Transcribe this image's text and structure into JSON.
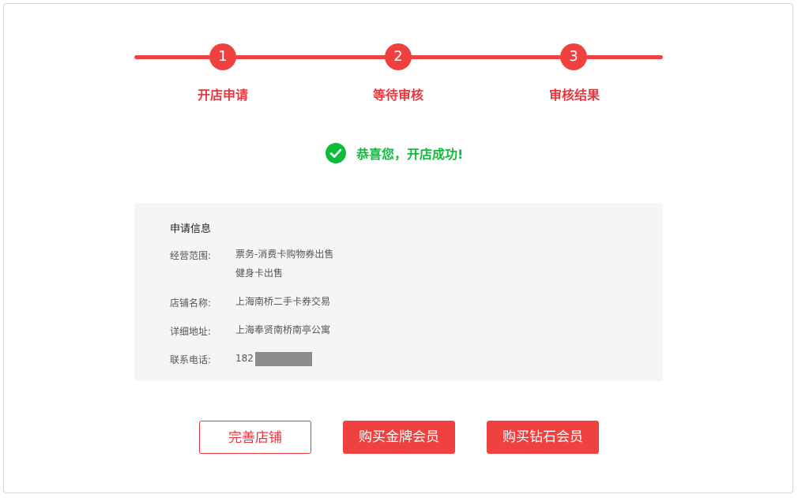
{
  "steps": [
    {
      "number": "1",
      "label": "开店申请"
    },
    {
      "number": "2",
      "label": "等待审核"
    },
    {
      "number": "3",
      "label": "审核结果"
    }
  ],
  "success": {
    "text": "恭喜您，开店成功!",
    "icon": "check-circle-icon",
    "color": "#0dbc3a"
  },
  "info": {
    "title": "申请信息",
    "rows": [
      {
        "label": "经营范围:",
        "value_lines": [
          "票务-消费卡购物券出售",
          "健身卡出售"
        ]
      },
      {
        "label": "店铺名称:",
        "value": "上海南桥二手卡券交易"
      },
      {
        "label": "详细地址:",
        "value": "上海奉贤南桥南亭公寓"
      },
      {
        "label": "联系电话:",
        "value": "182"
      }
    ]
  },
  "buttons": {
    "complete_shop": "完善店铺",
    "buy_gold": "购买金牌会员",
    "buy_diamond": "购买钻石会员"
  },
  "colors": {
    "accent": "#f04141",
    "success": "#0dbc3a"
  }
}
